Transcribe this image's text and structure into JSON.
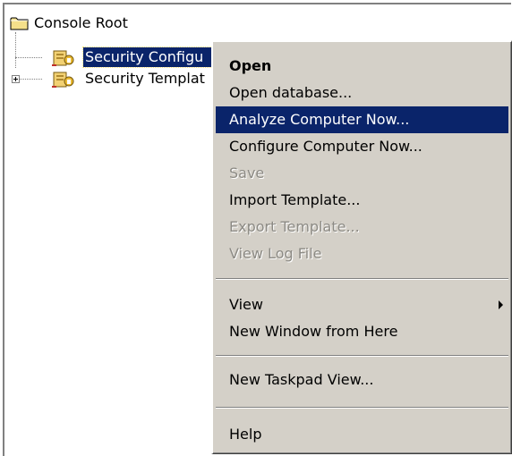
{
  "tree": {
    "root_label": "Console Root",
    "items": [
      {
        "label": "Security Configu",
        "selected": true,
        "icon": "security-snapin-icon"
      },
      {
        "label": "Security Templat",
        "selected": false,
        "icon": "security-snapin-icon"
      }
    ]
  },
  "context_menu": {
    "items": [
      {
        "label": "Open",
        "bold": true
      },
      {
        "label": "Open database..."
      },
      {
        "label": "Analyze Computer Now...",
        "highlighted": true
      },
      {
        "label": "Configure Computer Now..."
      },
      {
        "label": "Save",
        "disabled": true
      },
      {
        "label": "Import Template..."
      },
      {
        "label": "Export Template...",
        "disabled": true
      },
      {
        "label": "View Log File",
        "disabled": true
      },
      {
        "label": "View",
        "submenu": true
      },
      {
        "label": "New Window from Here"
      },
      {
        "label": "New Taskpad View..."
      },
      {
        "label": "Help"
      }
    ]
  },
  "colors": {
    "selection": "#0a246a",
    "menu_background": "#d4d0c8",
    "disabled_text": "#8c8a84",
    "folder_yellow": "#f5e08a"
  }
}
